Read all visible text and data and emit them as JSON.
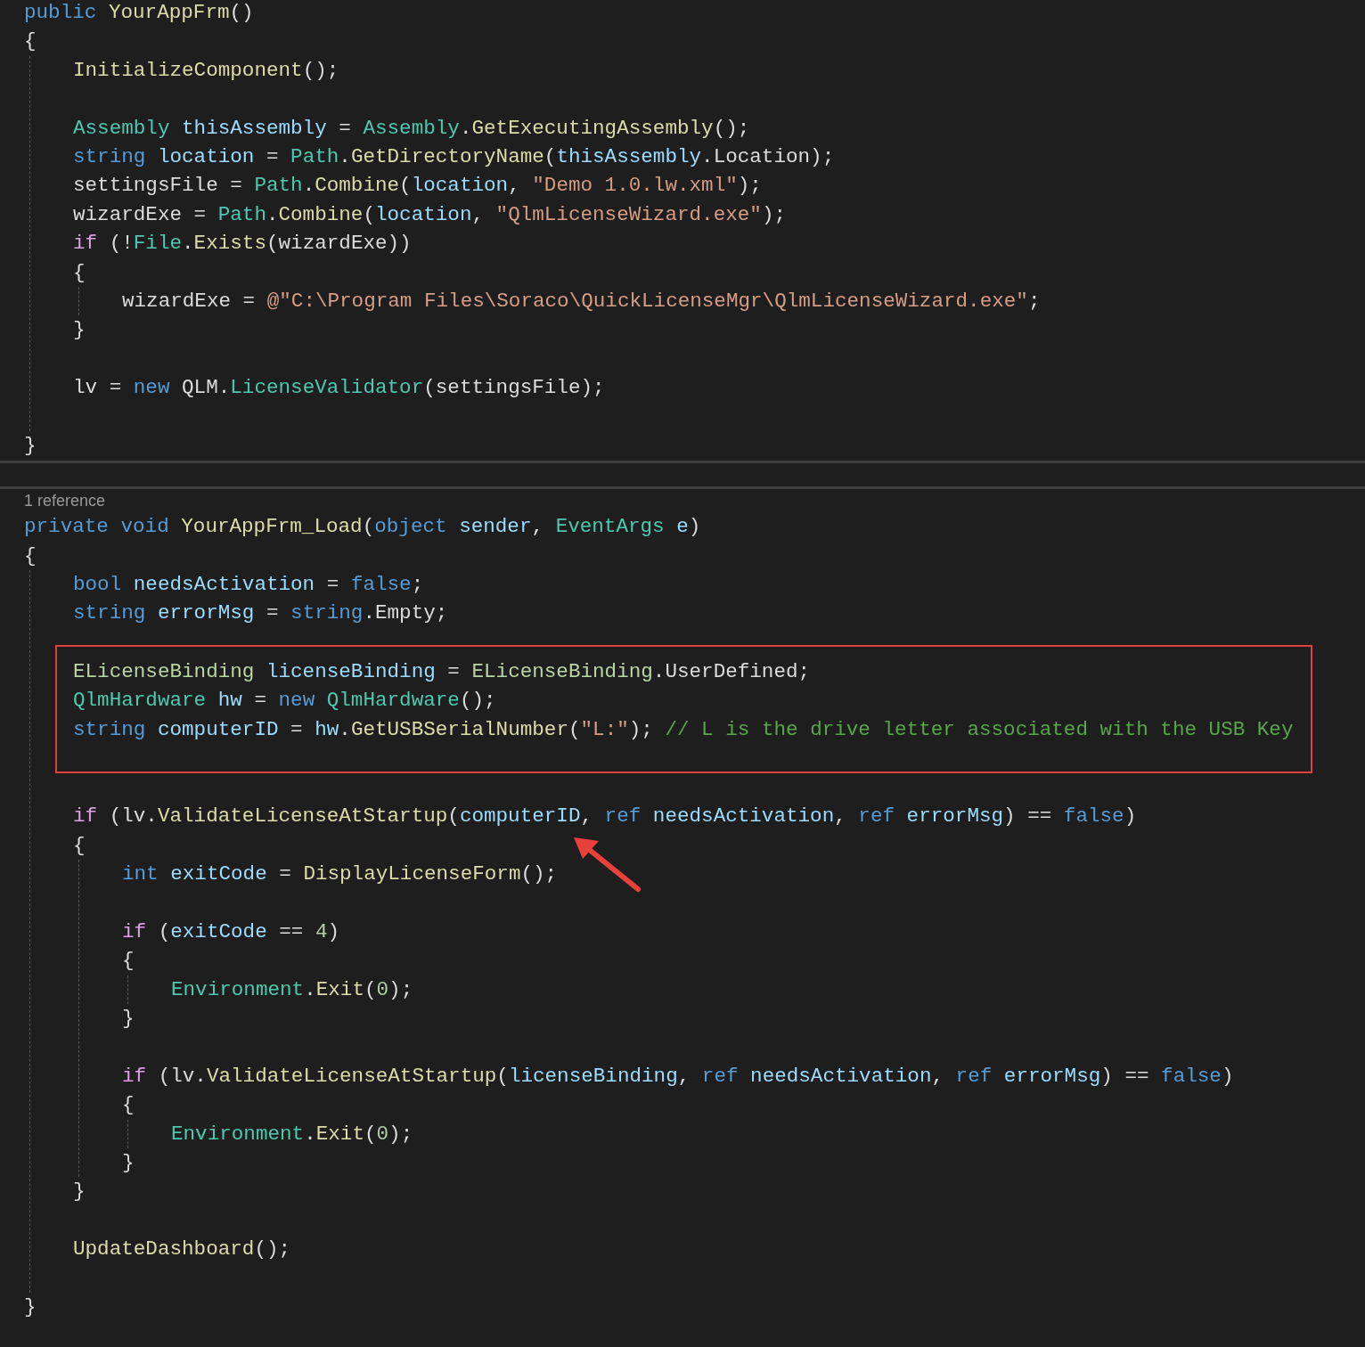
{
  "sections": [
    {
      "header": [
        {
          "kind": "kw",
          "text": "public "
        },
        {
          "kind": "method",
          "text": "YourAppFrm"
        },
        {
          "kind": "plain",
          "text": "()"
        }
      ],
      "body": {
        "kind": "block",
        "open": "{",
        "close": "}",
        "children": [
          {
            "kind": "line",
            "t": [
              {
                "kind": "method",
                "text": "InitializeComponent"
              },
              {
                "kind": "plain",
                "text": "();"
              }
            ]
          },
          {
            "kind": "blank"
          },
          {
            "kind": "line",
            "t": [
              {
                "kind": "type",
                "text": "Assembly "
              },
              {
                "kind": "local",
                "text": "thisAssembly"
              },
              {
                "kind": "plain",
                "text": " = "
              },
              {
                "kind": "type",
                "text": "Assembly"
              },
              {
                "kind": "plain",
                "text": "."
              },
              {
                "kind": "method",
                "text": "GetExecutingAssembly"
              },
              {
                "kind": "plain",
                "text": "();"
              }
            ]
          },
          {
            "kind": "line",
            "t": [
              {
                "kind": "kw",
                "text": "string "
              },
              {
                "kind": "local",
                "text": "location"
              },
              {
                "kind": "plain",
                "text": " = "
              },
              {
                "kind": "type",
                "text": "Path"
              },
              {
                "kind": "plain",
                "text": "."
              },
              {
                "kind": "method",
                "text": "GetDirectoryName"
              },
              {
                "kind": "plain",
                "text": "("
              },
              {
                "kind": "local",
                "text": "thisAssembly"
              },
              {
                "kind": "plain",
                "text": ".Location);"
              }
            ]
          },
          {
            "kind": "line",
            "t": [
              {
                "kind": "plain",
                "text": "settingsFile = "
              },
              {
                "kind": "type",
                "text": "Path"
              },
              {
                "kind": "plain",
                "text": "."
              },
              {
                "kind": "method",
                "text": "Combine"
              },
              {
                "kind": "plain",
                "text": "("
              },
              {
                "kind": "local",
                "text": "location"
              },
              {
                "kind": "plain",
                "text": ", "
              },
              {
                "kind": "str",
                "text": "\"Demo 1.0.lw.xml\""
              },
              {
                "kind": "plain",
                "text": ");"
              }
            ]
          },
          {
            "kind": "line",
            "t": [
              {
                "kind": "plain",
                "text": "wizardExe = "
              },
              {
                "kind": "type",
                "text": "Path"
              },
              {
                "kind": "plain",
                "text": "."
              },
              {
                "kind": "method",
                "text": "Combine"
              },
              {
                "kind": "plain",
                "text": "("
              },
              {
                "kind": "local",
                "text": "location"
              },
              {
                "kind": "plain",
                "text": ", "
              },
              {
                "kind": "str",
                "text": "\"QlmLicenseWizard.exe\""
              },
              {
                "kind": "plain",
                "text": ");"
              }
            ]
          },
          {
            "kind": "line",
            "t": [
              {
                "kind": "ctl",
                "text": "if"
              },
              {
                "kind": "plain",
                "text": " (!"
              },
              {
                "kind": "type",
                "text": "File"
              },
              {
                "kind": "plain",
                "text": "."
              },
              {
                "kind": "method",
                "text": "Exists"
              },
              {
                "kind": "plain",
                "text": "(wizardExe))"
              }
            ]
          },
          {
            "kind": "block",
            "open": "{",
            "close": "}",
            "children": [
              {
                "kind": "line",
                "t": [
                  {
                    "kind": "plain",
                    "text": "wizardExe = "
                  },
                  {
                    "kind": "str",
                    "text": "@\"C:\\Program Files\\Soraco\\QuickLicenseMgr\\QlmLicenseWizard.exe\""
                  },
                  {
                    "kind": "plain",
                    "text": ";"
                  }
                ]
              }
            ]
          },
          {
            "kind": "blank"
          },
          {
            "kind": "line",
            "t": [
              {
                "kind": "plain",
                "text": "lv = "
              },
              {
                "kind": "kw",
                "text": "new"
              },
              {
                "kind": "plain",
                "text": " QLM."
              },
              {
                "kind": "type",
                "text": "LicenseValidator"
              },
              {
                "kind": "plain",
                "text": "(settingsFile);"
              }
            ]
          },
          {
            "kind": "blank"
          }
        ]
      }
    },
    {
      "codelens": "1 reference",
      "header": [
        {
          "kind": "kw",
          "text": "private void "
        },
        {
          "kind": "method",
          "text": "YourAppFrm_Load"
        },
        {
          "kind": "plain",
          "text": "("
        },
        {
          "kind": "kw",
          "text": "object "
        },
        {
          "kind": "local",
          "text": "sender"
        },
        {
          "kind": "plain",
          "text": ", "
        },
        {
          "kind": "type",
          "text": "EventArgs "
        },
        {
          "kind": "local",
          "text": "e"
        },
        {
          "kind": "plain",
          "text": ")"
        }
      ],
      "body": {
        "kind": "block",
        "open": "{",
        "close": "}",
        "children": [
          {
            "kind": "line",
            "t": [
              {
                "kind": "kw",
                "text": "bool "
              },
              {
                "kind": "local",
                "text": "needsActivation"
              },
              {
                "kind": "plain",
                "text": " = "
              },
              {
                "kind": "kw",
                "text": "false"
              },
              {
                "kind": "plain",
                "text": ";"
              }
            ]
          },
          {
            "kind": "line",
            "t": [
              {
                "kind": "kw",
                "text": "string "
              },
              {
                "kind": "local",
                "text": "errorMsg"
              },
              {
                "kind": "plain",
                "text": " = "
              },
              {
                "kind": "kw",
                "text": "string"
              },
              {
                "kind": "plain",
                "text": ".Empty;"
              }
            ]
          },
          {
            "kind": "highlight",
            "children": [
              {
                "kind": "line",
                "t": [
                  {
                    "kind": "enum",
                    "text": "ELicenseBinding "
                  },
                  {
                    "kind": "local",
                    "text": "licenseBinding"
                  },
                  {
                    "kind": "plain",
                    "text": " = "
                  },
                  {
                    "kind": "enum",
                    "text": "ELicenseBinding"
                  },
                  {
                    "kind": "plain",
                    "text": ".UserDefined;"
                  }
                ]
              },
              {
                "kind": "line",
                "t": [
                  {
                    "kind": "type",
                    "text": "QlmHardware "
                  },
                  {
                    "kind": "local",
                    "text": "hw"
                  },
                  {
                    "kind": "plain",
                    "text": " = "
                  },
                  {
                    "kind": "kw",
                    "text": "new "
                  },
                  {
                    "kind": "type",
                    "text": "QlmHardware"
                  },
                  {
                    "kind": "plain",
                    "text": "();"
                  }
                ]
              },
              {
                "kind": "line",
                "t": [
                  {
                    "kind": "kw",
                    "text": "string "
                  },
                  {
                    "kind": "local",
                    "text": "computerID"
                  },
                  {
                    "kind": "plain",
                    "text": " = "
                  },
                  {
                    "kind": "local",
                    "text": "hw"
                  },
                  {
                    "kind": "plain",
                    "text": "."
                  },
                  {
                    "kind": "method",
                    "text": "GetUSBSerialNumber"
                  },
                  {
                    "kind": "plain",
                    "text": "("
                  },
                  {
                    "kind": "str",
                    "text": "\"L:\""
                  },
                  {
                    "kind": "plain",
                    "text": "); "
                  },
                  {
                    "kind": "comment",
                    "text": "// L is the drive letter associated with the USB Key"
                  }
                ]
              }
            ]
          },
          {
            "kind": "blank"
          },
          {
            "kind": "line",
            "t": [
              {
                "kind": "ctl",
                "text": "if"
              },
              {
                "kind": "plain",
                "text": " (lv."
              },
              {
                "kind": "method",
                "text": "ValidateLicenseAtStartup"
              },
              {
                "kind": "plain",
                "text": "("
              },
              {
                "kind": "local",
                "text": "computerID"
              },
              {
                "kind": "plain",
                "text": ", "
              },
              {
                "kind": "kw",
                "text": "ref "
              },
              {
                "kind": "local",
                "text": "needsActivation"
              },
              {
                "kind": "plain",
                "text": ", "
              },
              {
                "kind": "kw",
                "text": "ref "
              },
              {
                "kind": "local",
                "text": "errorMsg"
              },
              {
                "kind": "plain",
                "text": ") == "
              },
              {
                "kind": "kw",
                "text": "false"
              },
              {
                "kind": "plain",
                "text": ")"
              }
            ]
          },
          {
            "kind": "block",
            "open": "{",
            "close": "}",
            "children": [
              {
                "kind": "line",
                "t": [
                  {
                    "kind": "kw",
                    "text": "int "
                  },
                  {
                    "kind": "local",
                    "text": "exitCode"
                  },
                  {
                    "kind": "plain",
                    "text": " = "
                  },
                  {
                    "kind": "method",
                    "text": "DisplayLicenseForm"
                  },
                  {
                    "kind": "plain",
                    "text": "();"
                  }
                ]
              },
              {
                "kind": "blank"
              },
              {
                "kind": "line",
                "t": [
                  {
                    "kind": "ctl",
                    "text": "if"
                  },
                  {
                    "kind": "plain",
                    "text": " ("
                  },
                  {
                    "kind": "local",
                    "text": "exitCode"
                  },
                  {
                    "kind": "plain",
                    "text": " == "
                  },
                  {
                    "kind": "num",
                    "text": "4"
                  },
                  {
                    "kind": "plain",
                    "text": ")"
                  }
                ]
              },
              {
                "kind": "block",
                "open": "{",
                "close": "}",
                "children": [
                  {
                    "kind": "line",
                    "t": [
                      {
                        "kind": "type",
                        "text": "Environment"
                      },
                      {
                        "kind": "plain",
                        "text": "."
                      },
                      {
                        "kind": "method",
                        "text": "Exit"
                      },
                      {
                        "kind": "plain",
                        "text": "("
                      },
                      {
                        "kind": "num",
                        "text": "0"
                      },
                      {
                        "kind": "plain",
                        "text": ");"
                      }
                    ]
                  }
                ]
              },
              {
                "kind": "blank"
              },
              {
                "kind": "line",
                "t": [
                  {
                    "kind": "ctl",
                    "text": "if"
                  },
                  {
                    "kind": "plain",
                    "text": " (lv."
                  },
                  {
                    "kind": "method",
                    "text": "ValidateLicenseAtStartup"
                  },
                  {
                    "kind": "plain",
                    "text": "("
                  },
                  {
                    "kind": "local",
                    "text": "licenseBinding"
                  },
                  {
                    "kind": "plain",
                    "text": ", "
                  },
                  {
                    "kind": "kw",
                    "text": "ref "
                  },
                  {
                    "kind": "local",
                    "text": "needsActivation"
                  },
                  {
                    "kind": "plain",
                    "text": ", "
                  },
                  {
                    "kind": "kw",
                    "text": "ref "
                  },
                  {
                    "kind": "local",
                    "text": "errorMsg"
                  },
                  {
                    "kind": "plain",
                    "text": ") == "
                  },
                  {
                    "kind": "kw",
                    "text": "false"
                  },
                  {
                    "kind": "plain",
                    "text": ")"
                  }
                ]
              },
              {
                "kind": "block",
                "open": "{",
                "close": "}",
                "children": [
                  {
                    "kind": "line",
                    "t": [
                      {
                        "kind": "type",
                        "text": "Environment"
                      },
                      {
                        "kind": "plain",
                        "text": "."
                      },
                      {
                        "kind": "method",
                        "text": "Exit"
                      },
                      {
                        "kind": "plain",
                        "text": "("
                      },
                      {
                        "kind": "num",
                        "text": "0"
                      },
                      {
                        "kind": "plain",
                        "text": ");"
                      }
                    ]
                  }
                ]
              }
            ]
          },
          {
            "kind": "blank"
          },
          {
            "kind": "line",
            "t": [
              {
                "kind": "method",
                "text": "UpdateDashboard"
              },
              {
                "kind": "plain",
                "text": "();"
              }
            ]
          },
          {
            "kind": "blank"
          }
        ]
      }
    }
  ]
}
